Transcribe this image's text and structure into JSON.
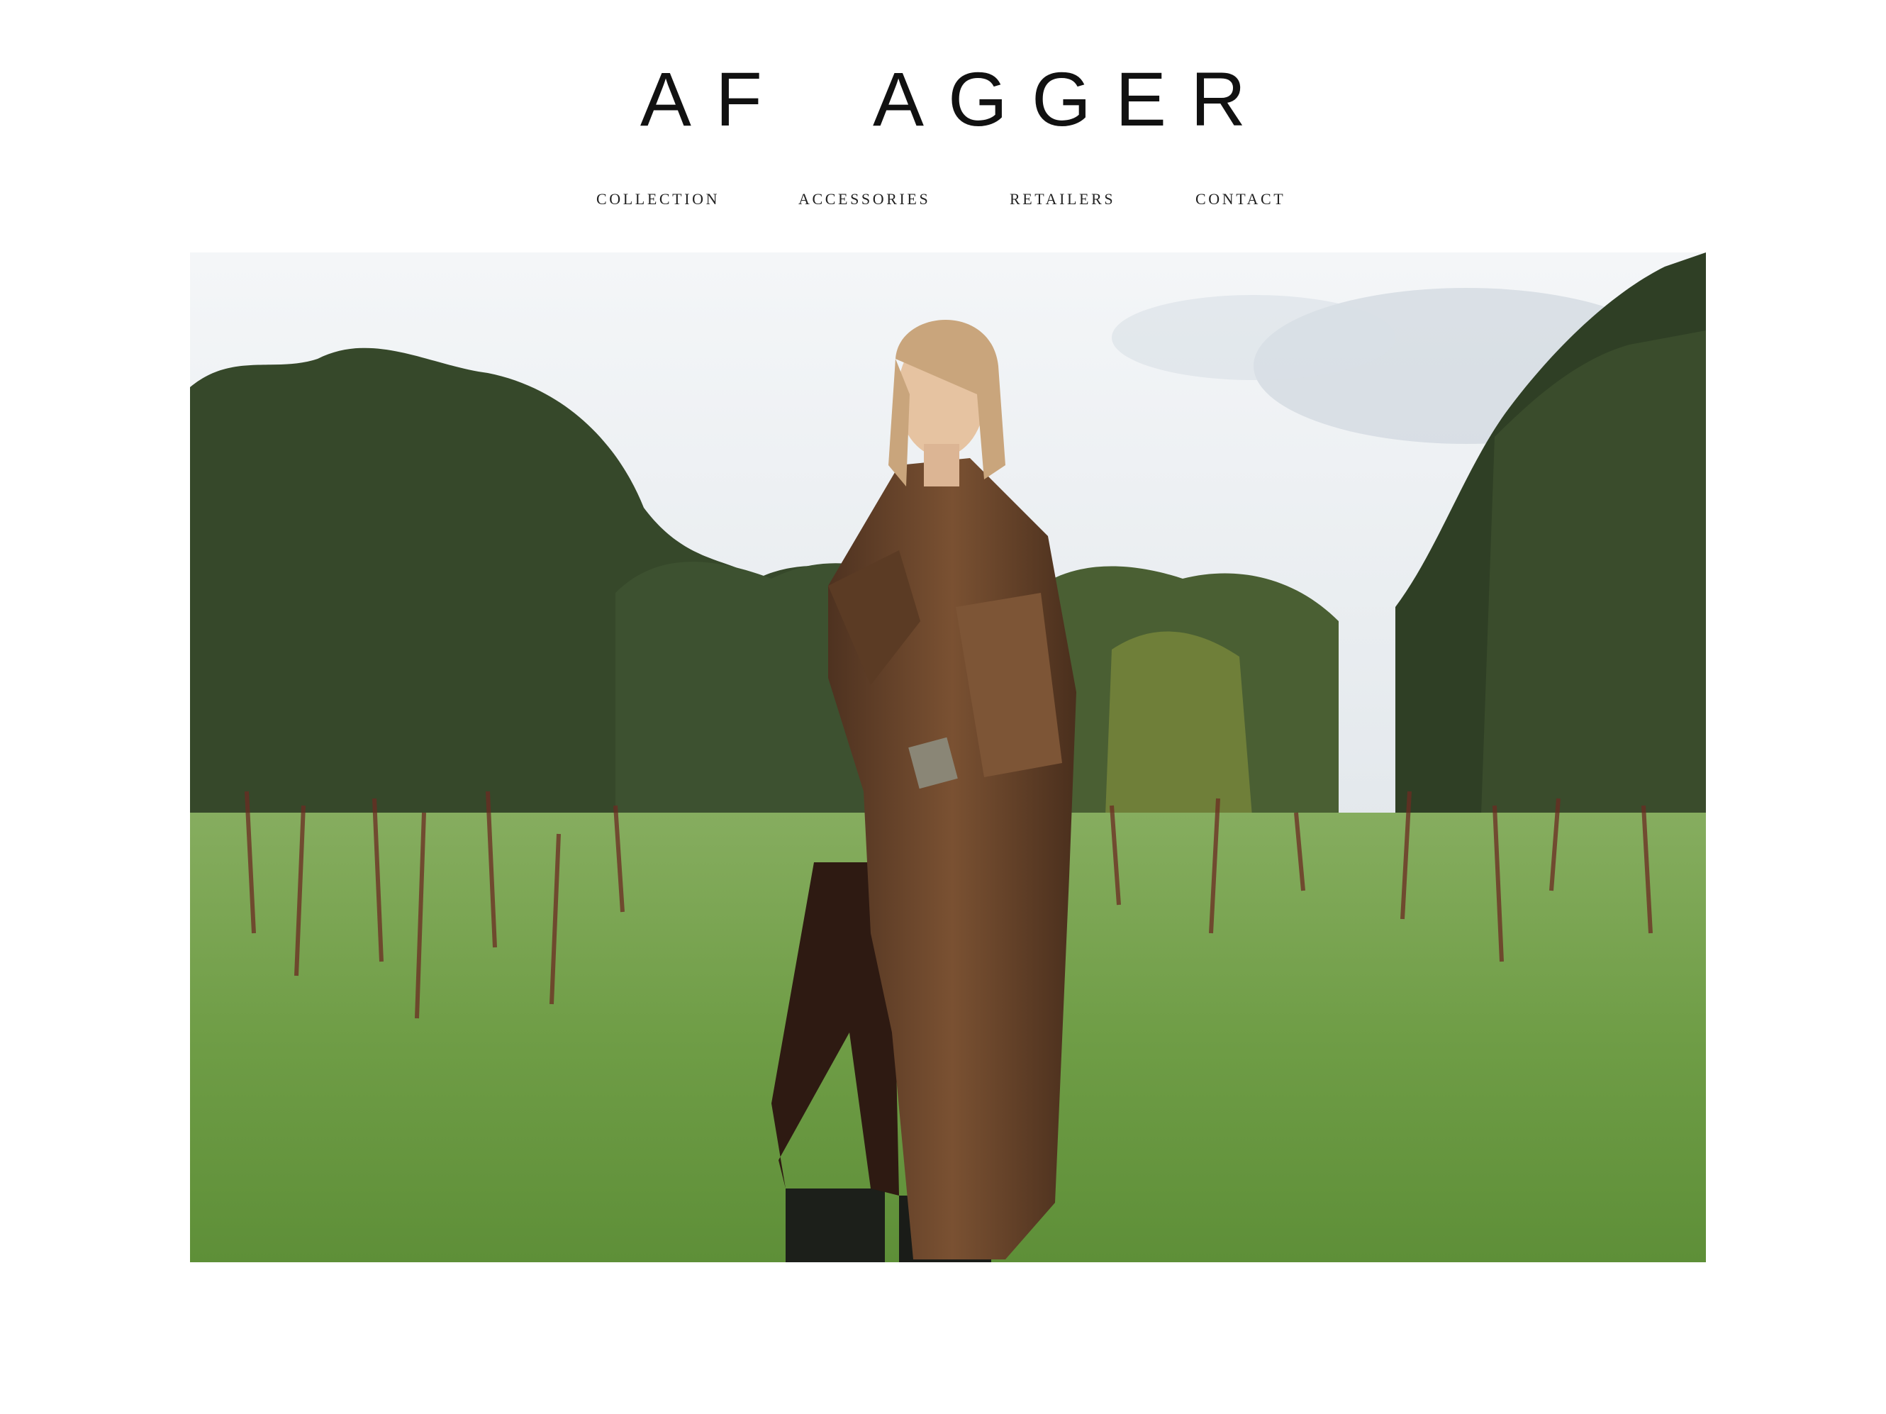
{
  "header": {
    "logo_text": "AF  AGGER"
  },
  "nav": {
    "items": [
      {
        "label": "COLLECTION"
      },
      {
        "label": "ACCESSORIES"
      },
      {
        "label": "RETAILERS"
      },
      {
        "label": "CONTACT"
      }
    ]
  },
  "hero": {
    "image_subject": "model-in-field",
    "colors": {
      "sky": "#e6ebef",
      "trees": "#3a4a2a",
      "grass": "#6f9e48",
      "coat": "#6a4529"
    }
  }
}
